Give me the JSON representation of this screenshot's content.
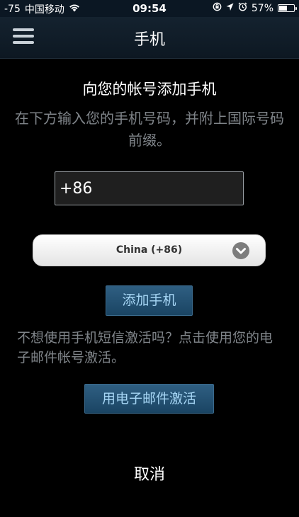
{
  "status_bar": {
    "signal": "-75",
    "carrier": "中国移动",
    "time": "09:54",
    "battery_percent": "57%",
    "battery_level": 0.57,
    "icons": [
      "wifi-icon",
      "orientation-lock-icon",
      "location-arrow-icon",
      "alarm-icon",
      "battery-icon"
    ]
  },
  "nav": {
    "title": "手机",
    "menu_icon": "hamburger-menu-icon"
  },
  "content": {
    "heading": "向您的帐号添加手机",
    "instructions": "在下方输入您的手机号码，并附上国际号码前缀。",
    "phone_value": "+86",
    "country_selected": "China (+86)",
    "add_phone_label": "添加手机",
    "alternative_text": "不想使用手机短信激活吗？点击使用您的电子邮件帐号激活。",
    "email_activate_label": "用电子邮件激活",
    "cancel_label": "取消"
  },
  "colors": {
    "background": "#000000",
    "nav_background": "#14222f",
    "button_text": "#a6d6f5",
    "muted_text": "#7f8489"
  }
}
